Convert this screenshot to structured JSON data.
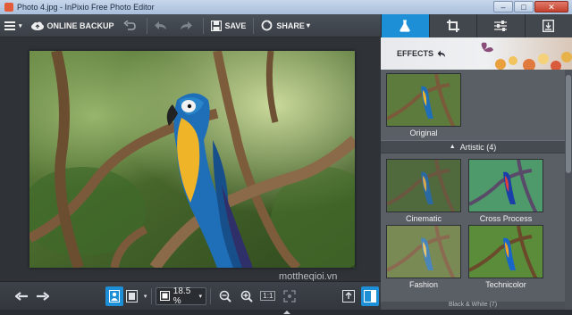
{
  "window": {
    "title": "Photo 4.jpg - InPixio Free Photo Editor",
    "minimize_label": "–",
    "maximize_label": "□",
    "close_label": "✕"
  },
  "toolbar": {
    "menu_icon": "hamburger-icon",
    "online_backup_label": "ONLINE BACKUP",
    "save_label": "SAVE",
    "share_label": "SHARE",
    "share_caret": "▾"
  },
  "panel_tabs": [
    {
      "name": "effects",
      "icon": "flask-icon",
      "active": true
    },
    {
      "name": "crop",
      "icon": "crop-icon",
      "active": false
    },
    {
      "name": "adjust",
      "icon": "sliders-icon",
      "active": false
    },
    {
      "name": "export",
      "icon": "download-box-icon",
      "active": false
    }
  ],
  "effects_panel": {
    "header_label": "EFFECTS",
    "original_label": "Original",
    "section_title": "Artistic (4)",
    "items": [
      {
        "label": "Cinematic"
      },
      {
        "label": "Cross Process"
      },
      {
        "label": "Fashion"
      },
      {
        "label": "Technicolor"
      }
    ],
    "next_section_partial": "Black & White (7)"
  },
  "bottombar": {
    "zoom_value": "18.5 %",
    "zoom_caret": "▾",
    "fit_label": "1:1"
  },
  "watermark_text": "mottheqioi.vn",
  "colors": {
    "accent": "#1d8fd6",
    "panel_bg": "#5a5f66",
    "toolbar_bg": "#3b4047"
  }
}
